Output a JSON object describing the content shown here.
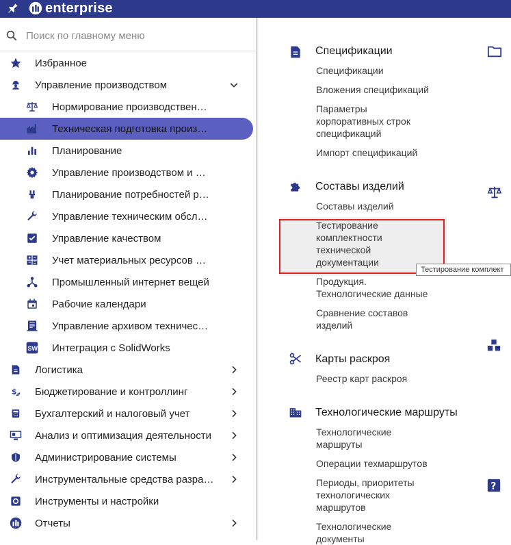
{
  "app": {
    "logo_text": "enterprise"
  },
  "search": {
    "placeholder": "Поиск по главному меню",
    "value": ""
  },
  "menu": [
    {
      "label": "Избранное",
      "icon": "star-icon",
      "level": 1
    },
    {
      "label": "Управление производством",
      "icon": "worker-icon",
      "level": 1,
      "expanded": true
    },
    {
      "label": "Нормирование производственных процессов",
      "icon": "scales-icon",
      "level": 2
    },
    {
      "label": "Техническая подготовка производства",
      "icon": "factory-icon",
      "level": 2,
      "active": true
    },
    {
      "label": "Планирование",
      "icon": "bar-chart-icon",
      "level": 2
    },
    {
      "label": "Управление производством и контролем",
      "icon": "gear-icon",
      "level": 2
    },
    {
      "label": "Планирование потребностей ресурсов",
      "icon": "tools-icon",
      "level": 2
    },
    {
      "label": "Управление техническим обслуживанием",
      "icon": "wrench-icon",
      "level": 2
    },
    {
      "label": "Управление качеством",
      "icon": "checkbox-icon",
      "level": 2
    },
    {
      "label": "Учет материальных ресурсов производства",
      "icon": "ledger-icon",
      "level": 2
    },
    {
      "label": "Промышленный интернет вещей",
      "icon": "network-icon",
      "level": 2
    },
    {
      "label": "Рабочие календари",
      "icon": "calendar-icon",
      "level": 2
    },
    {
      "label": "Управление архивом технической документации",
      "icon": "archive-icon",
      "level": 2
    },
    {
      "label": "Интеграция с SolidWorks",
      "icon": "solidworks-icon",
      "level": 2
    },
    {
      "label": "Логистика",
      "icon": "document-icon",
      "level": 1
    },
    {
      "label": "Бюджетирование и контроллинг",
      "icon": "money-icon",
      "level": 1
    },
    {
      "label": "Бухгалтерский и налоговый учет",
      "icon": "calculator-icon",
      "level": 1
    },
    {
      "label": "Анализ и оптимизация деятельности",
      "icon": "monitor-icon",
      "level": 1
    },
    {
      "label": "Администрирование системы",
      "icon": "shield-icon",
      "level": 1
    },
    {
      "label": "Инструментальные средства разработки",
      "icon": "wrench-icon",
      "level": 1
    },
    {
      "label": "Инструменты и настройки",
      "icon": "settings-icon",
      "level": 1
    },
    {
      "label": "Отчеты",
      "icon": "logo-icon",
      "level": 1
    }
  ],
  "content": {
    "groups": [
      {
        "title": "Спецификации",
        "icon": "document-icon",
        "links": [
          "Спецификации",
          "Вложения спецификаций",
          "Параметры корпоративных строк спецификаций",
          "Импорт спецификаций"
        ]
      },
      {
        "title": "Составы изделий",
        "icon": "puzzle-icon",
        "links": [
          "Составы изделий",
          "Тестирование комплектности технической документации",
          "Продукция. Технологические данные",
          "Сравнение составов изделий"
        ]
      },
      {
        "title": "Карты раскроя",
        "icon": "scissors-icon",
        "links": [
          "Реестр карт раскроя"
        ]
      },
      {
        "title": "Технологические маршруты",
        "icon": "building-icon",
        "links": [
          "Технологические маршруты",
          "Операции техмаршрутов",
          "Периоды, приоритеты технологических маршрутов",
          "Технологические документы"
        ]
      }
    ],
    "tooltip": "Тестирование комплект"
  },
  "colors": {
    "topbar": "#2d3a8c",
    "active_pill": "#5a5fc0",
    "icon": "#2d3a8c",
    "highlight_box": "#e02020"
  }
}
